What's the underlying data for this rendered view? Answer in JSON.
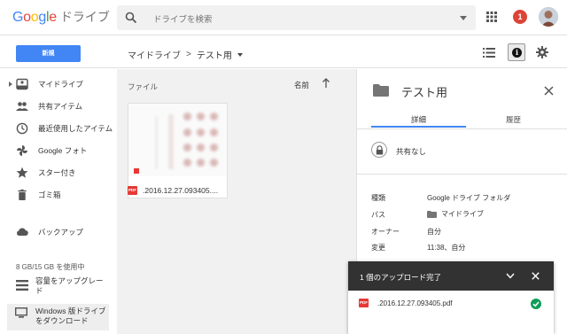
{
  "app": {
    "logo_google": "Google",
    "logo_product": "ドライブ",
    "notification_count": "1",
    "colors": {
      "accent": "#4285f4",
      "danger": "#db4437",
      "success": "#0f9d58"
    }
  },
  "search": {
    "placeholder": "ドライブを検索"
  },
  "toolbar": {
    "new_label": "新規",
    "breadcrumb_root": "マイドライブ",
    "breadcrumb_sep": ">",
    "breadcrumb_current": "テスト用"
  },
  "sidebar": {
    "items": [
      {
        "label": "マイドライブ",
        "icon": "drive-icon"
      },
      {
        "label": "共有アイテム",
        "icon": "people-icon"
      },
      {
        "label": "最近使用したアイテム",
        "icon": "clock-icon"
      },
      {
        "label": "Google フォト",
        "icon": "pinwheel-icon"
      },
      {
        "label": "スター付き",
        "icon": "star-icon"
      },
      {
        "label": "ゴミ箱",
        "icon": "trash-icon"
      },
      {
        "label": "バックアップ",
        "icon": "cloud-icon"
      }
    ],
    "storage": "8 GB/15 GB を使用中",
    "upgrade_line1": "容量をアップグレー",
    "upgrade_line2": "ド",
    "windows_line1": "Windows 版ドライブ",
    "windows_line2": "をダウンロード"
  },
  "main": {
    "section_label": "ファイル",
    "sort_label": "名前",
    "file": {
      "name": ".2016.12.27.093405....",
      "type_badge": "PDF"
    }
  },
  "details": {
    "title": "テスト用",
    "tab_details": "詳細",
    "tab_history": "履歴",
    "share_status": "共有なし",
    "properties": [
      {
        "key": "種類",
        "value": "Google ドライブ フォルダ"
      },
      {
        "key": "パス",
        "value": "マイドライブ"
      },
      {
        "key": "オーナー",
        "value": "自分"
      },
      {
        "key": "変更",
        "value": "11:38、自分"
      }
    ]
  },
  "upload": {
    "title": "1 個のアップロード完了",
    "file_name": ".2016.12.27.093405.pdf",
    "type_badge": "PDF"
  }
}
